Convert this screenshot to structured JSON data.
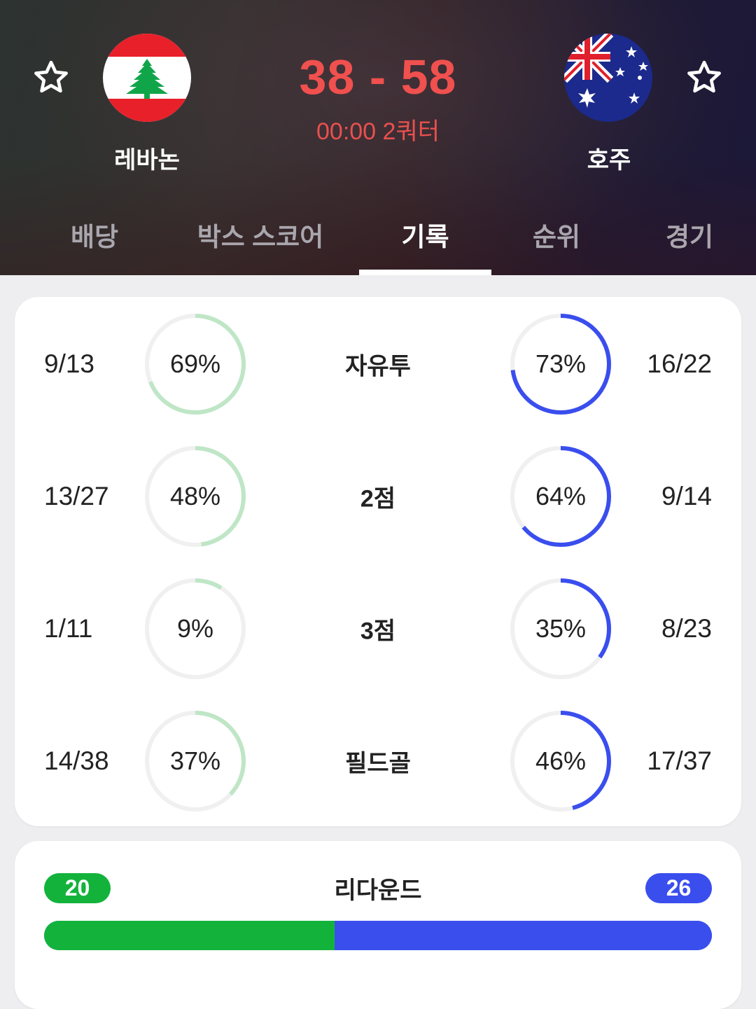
{
  "match": {
    "home": {
      "name": "레바논",
      "flag_icon": "lebanon-flag-icon"
    },
    "away": {
      "name": "호주",
      "flag_icon": "australia-flag-icon"
    },
    "score": "38 - 58",
    "clock": "00:00 2쿼터",
    "favorite_icon": "star-outline-icon"
  },
  "tabs": [
    {
      "label": "배당",
      "active": false
    },
    {
      "label": "박스 스코어",
      "active": false
    },
    {
      "label": "기록",
      "active": true
    },
    {
      "label": "순위",
      "active": false
    },
    {
      "label": "경기",
      "active": false
    }
  ],
  "stats": [
    {
      "label": "자유투",
      "home_count": "9/13",
      "home_pct": 69,
      "home_pct_text": "69%",
      "away_pct": 73,
      "away_pct_text": "73%",
      "away_count": "16/22"
    },
    {
      "label": "2점",
      "home_count": "13/27",
      "home_pct": 48,
      "home_pct_text": "48%",
      "away_pct": 64,
      "away_pct_text": "64%",
      "away_count": "9/14"
    },
    {
      "label": "3점",
      "home_count": "1/11",
      "home_pct": 9,
      "home_pct_text": "9%",
      "away_pct": 35,
      "away_pct_text": "35%",
      "away_count": "8/23"
    },
    {
      "label": "필드골",
      "home_count": "14/38",
      "home_pct": 37,
      "home_pct_text": "37%",
      "away_pct": 46,
      "away_pct_text": "46%",
      "away_count": "17/37"
    }
  ],
  "rebounds": {
    "label": "리다운드",
    "home": "20",
    "away": "26",
    "home_value": 20,
    "away_value": 26
  },
  "colors": {
    "score": "#f0504e",
    "home_ring": "#bfe6c6",
    "away_ring": "#3a4eee",
    "ring_track": "#f0f0f0",
    "home_bar": "#13b33b",
    "away_bar": "#3a4eee"
  }
}
